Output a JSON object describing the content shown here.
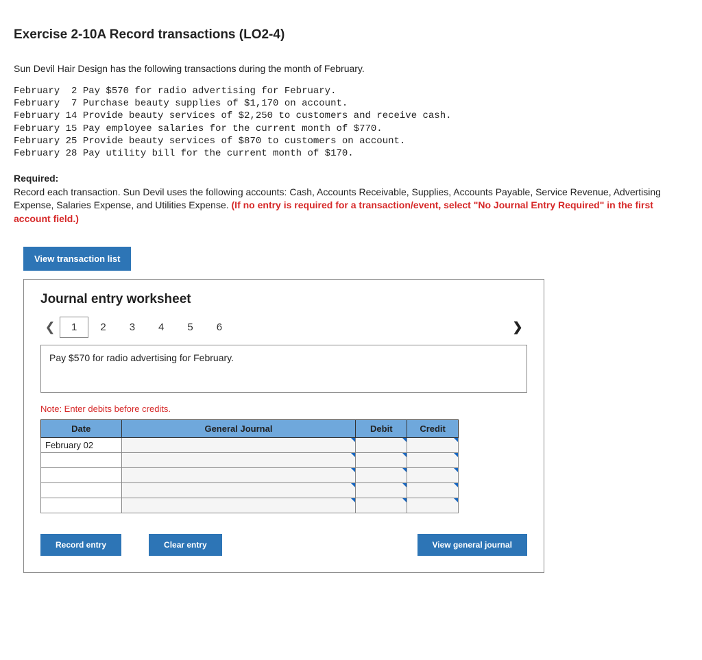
{
  "header": {
    "title": "Exercise 2-10A Record transactions (LO2-4)"
  },
  "intro": "Sun Devil Hair Design has the following transactions during the month of February.",
  "transactions_block": "February  2 Pay $570 for radio advertising for February.\nFebruary  7 Purchase beauty supplies of $1,170 on account.\nFebruary 14 Provide beauty services of $2,250 to customers and receive cash.\nFebruary 15 Pay employee salaries for the current month of $770.\nFebruary 25 Provide beauty services of $870 to customers on account.\nFebruary 28 Pay utility bill for the current month of $170.",
  "required": {
    "label": "Required:",
    "text_plain": "Record each transaction. Sun Devil uses the following accounts: Cash, Accounts Receivable, Supplies, Accounts Payable, Service Revenue, Advertising Expense, Salaries Expense, and Utilities Expense. ",
    "text_red": "(If no entry is required for a transaction/event, select \"No Journal Entry Required\" in the first account field.)"
  },
  "buttons": {
    "view_transaction_list": "View transaction list",
    "record_entry": "Record entry",
    "clear_entry": "Clear entry",
    "view_general_journal": "View general journal"
  },
  "worksheet": {
    "title": "Journal entry worksheet",
    "tabs": [
      "1",
      "2",
      "3",
      "4",
      "5",
      "6"
    ],
    "active_tab": "1",
    "description": "Pay $570 for radio advertising for February.",
    "note": "Note: Enter debits before credits.",
    "columns": {
      "date": "Date",
      "journal": "General Journal",
      "debit": "Debit",
      "credit": "Credit"
    },
    "rows": [
      {
        "date": "February 02",
        "journal": "",
        "debit": "",
        "credit": ""
      },
      {
        "date": "",
        "journal": "",
        "debit": "",
        "credit": ""
      },
      {
        "date": "",
        "journal": "",
        "debit": "",
        "credit": ""
      },
      {
        "date": "",
        "journal": "",
        "debit": "",
        "credit": ""
      },
      {
        "date": "",
        "journal": "",
        "debit": "",
        "credit": ""
      }
    ]
  }
}
